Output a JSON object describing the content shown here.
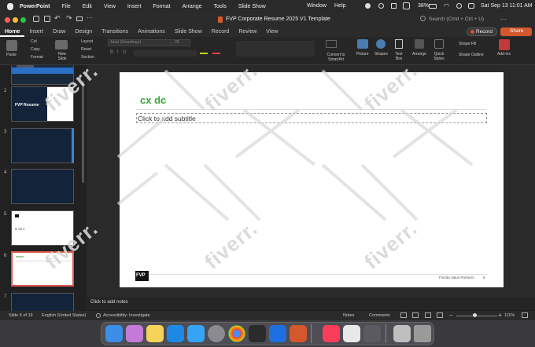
{
  "menubar": {
    "app": "PowerPoint",
    "items": [
      "File",
      "Edit",
      "View",
      "Insert",
      "Format",
      "Arrange",
      "Tools",
      "Slide Show"
    ],
    "window": "Window",
    "help": "Help",
    "battery": "38%",
    "datetime": "Sat Sep 13  11:01 AM"
  },
  "titlebar": {
    "doc_title": "FVP Corporate Resume 2025 V1 Template",
    "search_placeholder": "Search (Cmd + Ctrl + U)",
    "record": "Record",
    "share": "Share"
  },
  "ribbon_tabs": [
    "Home",
    "Insert",
    "Draw",
    "Design",
    "Transitions",
    "Animations",
    "Slide Show",
    "Record",
    "Review",
    "View"
  ],
  "ribbon": {
    "paste": "Paste",
    "cut": "Cut",
    "copy": "Copy",
    "format": "Format",
    "new_slide": "New Slide",
    "layout": "Layout",
    "reset": "Reset",
    "section": "Section",
    "font": "Arial (Headings)",
    "font_size": "25",
    "convert": "Convert to SmartArt",
    "picture": "Picture",
    "shapes": "Shapes",
    "textbox": "Text Box",
    "arrange": "Arrange",
    "quick_styles": "Quick Styles",
    "shape_fill": "Shape Fill",
    "shape_outline": "Shape Outline",
    "addins": "Add-ins"
  },
  "thumbs": {
    "numbers": [
      "2",
      "3",
      "4",
      "5",
      "6",
      "7"
    ],
    "t2_title": "FVP Resume",
    "t5_text": "C cx c"
  },
  "slide": {
    "title": "cx dc",
    "subtitle_placeholder": "Click to add subtitle",
    "logo": "FVP",
    "footer_company": "Florida Value Partners",
    "footer_page": "6",
    "watermark": "fiverr."
  },
  "notes": {
    "placeholder": "Click to add notes"
  },
  "status": {
    "slide": "Slide 6 of 19",
    "language": "English (United States)",
    "accessibility": "Accessibility: Investigate",
    "notes": "Notes",
    "comments": "Comments",
    "zoom": "111%"
  },
  "colors": {
    "accent_green": "#3aa53a",
    "record_red": "#e04a3a",
    "share_orange": "#d4572d",
    "selected_thumb": "#e0574a"
  }
}
